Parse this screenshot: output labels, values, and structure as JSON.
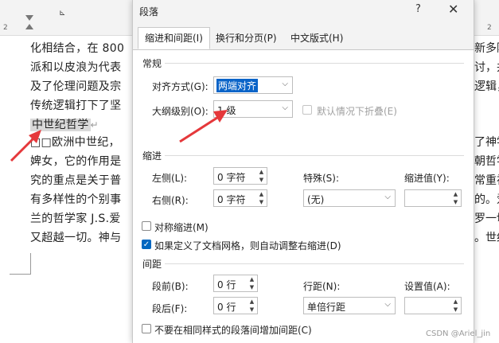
{
  "document": {
    "ruler": {
      "tick_2": "2",
      "tick_4": "2",
      "tab_marker": "⊾"
    },
    "lines": [
      "化相结合，在 800",
      "派和以皮浪为代表",
      "及了伦理问题及宗",
      "传统逻辑打下了坚"
    ],
    "heading": "中世纪哲学",
    "pilcrow": "↵",
    "lines2": [
      "□□欧洲中世纪，",
      "婢女，它的作用是",
      "究的重点是关于普",
      "有多样性的个别事",
      "兰的哲学家 J.S.爱",
      "又超越一切。神与"
    ],
    "right_lines": [
      "新多阿",
      "讨，并",
      "逻辑，",
      "",
      "了神学",
      "朝哲学",
      "常重视",
      "的。爱",
      "罗一切",
      "。世纪"
    ]
  },
  "dialog": {
    "title": "段落",
    "help": "?",
    "close": "✕",
    "tabs": [
      "缩进和间距(I)",
      "换行和分页(P)",
      "中文版式(H)"
    ],
    "general": {
      "section": "常规",
      "alignment_label": "对齐方式(G):",
      "alignment_value": "两端对齐",
      "outline_label": "大纲级别(O):",
      "outline_value": "1 级",
      "collapse_label": "默认情况下折叠(E)"
    },
    "indent": {
      "section": "缩进",
      "left_label": "左侧(L):",
      "left_value": "0 字符",
      "right_label": "右侧(R):",
      "right_value": "0 字符",
      "special_label": "特殊(S):",
      "special_value": "(无)",
      "indent_value_label": "缩进值(Y):",
      "indent_value": "",
      "mirror_label": "对称缩进(M)",
      "auto_adjust_label": "如果定义了文档网格，则自动调整右缩进(D)"
    },
    "spacing": {
      "section": "间距",
      "before_label": "段前(B):",
      "before_value": "0 行",
      "after_label": "段后(F):",
      "after_value": "0 行",
      "line_spacing_label": "行距(N):",
      "line_spacing_value": "单倍行距",
      "setting_label": "设置值(A):",
      "setting_value": "",
      "no_space_label": "不要在相同样式的段落间增加间距(C)"
    }
  },
  "watermark": "CSDN @Ariel_jin",
  "colors": {
    "arrow": "#e5383b",
    "selection": "#0a64c8",
    "checkbox": "#0067c0"
  }
}
